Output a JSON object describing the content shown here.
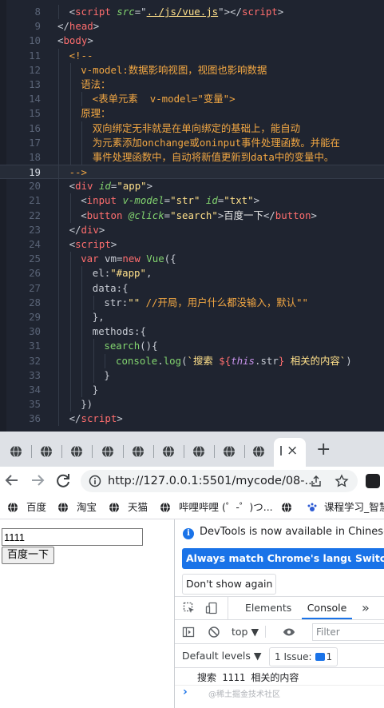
{
  "editor": {
    "lines": [
      {
        "n": "8",
        "indent": 1,
        "tokens": [
          [
            "punc",
            "<"
          ],
          [
            "tag",
            "script"
          ],
          [
            "punc",
            " "
          ],
          [
            "attr",
            "src"
          ],
          [
            "punc",
            "=\""
          ],
          [
            "url",
            "../js/vue.js"
          ],
          [
            "punc",
            "\">"
          ],
          [
            "punc",
            "</"
          ],
          [
            "tag",
            "script"
          ],
          [
            "punc",
            ">"
          ]
        ]
      },
      {
        "n": "9",
        "indent": 0,
        "tokens": [
          [
            "punc",
            "</"
          ],
          [
            "tag",
            "head"
          ],
          [
            "punc",
            ">"
          ]
        ]
      },
      {
        "n": "10",
        "indent": 0,
        "tokens": [
          [
            "punc",
            "<"
          ],
          [
            "tag",
            "body"
          ],
          [
            "punc",
            ">"
          ]
        ]
      },
      {
        "n": "11",
        "indent": 1,
        "tokens": [
          [
            "cm",
            "<!--"
          ]
        ]
      },
      {
        "n": "12",
        "indent": 2,
        "tokens": [
          [
            "cm",
            "v-model:数据影响视图，视图也影响数据"
          ]
        ]
      },
      {
        "n": "13",
        "indent": 2,
        "tokens": [
          [
            "cm",
            "语法："
          ]
        ]
      },
      {
        "n": "14",
        "indent": 3,
        "tokens": [
          [
            "cm",
            "<表单元素  v-model=\"变量\">"
          ]
        ]
      },
      {
        "n": "15",
        "indent": 2,
        "tokens": [
          [
            "cm",
            "原理："
          ]
        ]
      },
      {
        "n": "16",
        "indent": 3,
        "tokens": [
          [
            "cm",
            "双向绑定无非就是在单向绑定的基础上，能自动"
          ]
        ]
      },
      {
        "n": "17",
        "indent": 3,
        "tokens": [
          [
            "cm",
            "为元素添加onchange或oninput事件处理函数。并能在"
          ]
        ]
      },
      {
        "n": "18",
        "indent": 3,
        "tokens": [
          [
            "cm",
            "事件处理函数中，自动将新值更新到data中的变量中。"
          ]
        ]
      },
      {
        "n": "19",
        "indent": 1,
        "active": true,
        "tokens": [
          [
            "cm",
            "-->"
          ]
        ]
      },
      {
        "n": "20",
        "indent": 1,
        "tokens": [
          [
            "punc",
            "<"
          ],
          [
            "tag",
            "div"
          ],
          [
            "punc",
            " "
          ],
          [
            "attr",
            "id"
          ],
          [
            "punc",
            "="
          ],
          [
            "str",
            "\"app\""
          ],
          [
            "punc",
            ">"
          ]
        ]
      },
      {
        "n": "21",
        "indent": 2,
        "tokens": [
          [
            "punc",
            "<"
          ],
          [
            "tag",
            "input"
          ],
          [
            "punc",
            " "
          ],
          [
            "attr",
            "v-model"
          ],
          [
            "punc",
            "="
          ],
          [
            "str",
            "\"str\""
          ],
          [
            "punc",
            " "
          ],
          [
            "attr",
            "id"
          ],
          [
            "punc",
            "="
          ],
          [
            "str",
            "\"txt\""
          ],
          [
            "punc",
            ">"
          ]
        ]
      },
      {
        "n": "22",
        "indent": 2,
        "tokens": [
          [
            "punc",
            "<"
          ],
          [
            "tag",
            "button"
          ],
          [
            "punc",
            " "
          ],
          [
            "attr",
            "@click"
          ],
          [
            "punc",
            "="
          ],
          [
            "str",
            "\"search\""
          ],
          [
            "punc",
            ">"
          ],
          [
            "txt",
            "百度一下"
          ],
          [
            "punc",
            "</"
          ],
          [
            "tag",
            "button"
          ],
          [
            "punc",
            ">"
          ]
        ]
      },
      {
        "n": "23",
        "indent": 1,
        "tokens": [
          [
            "punc",
            "</"
          ],
          [
            "tag",
            "div"
          ],
          [
            "punc",
            ">"
          ]
        ]
      },
      {
        "n": "24",
        "indent": 1,
        "tokens": [
          [
            "punc",
            "<"
          ],
          [
            "tag",
            "script"
          ],
          [
            "punc",
            ">"
          ]
        ]
      },
      {
        "n": "25",
        "indent": 2,
        "tokens": [
          [
            "kw",
            "var"
          ],
          [
            "punc",
            " vm="
          ],
          [
            "kw",
            "new"
          ],
          [
            "punc",
            " "
          ],
          [
            "fn",
            "Vue"
          ],
          [
            "punc",
            "({"
          ]
        ]
      },
      {
        "n": "26",
        "indent": 3,
        "tokens": [
          [
            "punc",
            "el:"
          ],
          [
            "str",
            "\"#app\""
          ],
          [
            "punc",
            ","
          ]
        ]
      },
      {
        "n": "27",
        "indent": 3,
        "tokens": [
          [
            "punc",
            "data:{"
          ]
        ]
      },
      {
        "n": "28",
        "indent": 4,
        "tokens": [
          [
            "punc",
            "str:"
          ],
          [
            "str",
            "\"\""
          ],
          [
            "punc",
            " "
          ],
          [
            "cm",
            "//开局，用户什么都没输入，默认\"\""
          ]
        ]
      },
      {
        "n": "29",
        "indent": 3,
        "tokens": [
          [
            "punc",
            "},"
          ]
        ]
      },
      {
        "n": "30",
        "indent": 3,
        "tokens": [
          [
            "punc",
            "methods:{"
          ]
        ]
      },
      {
        "n": "31",
        "indent": 4,
        "tokens": [
          [
            "fn",
            "search"
          ],
          [
            "punc",
            "(){"
          ]
        ]
      },
      {
        "n": "32",
        "indent": 5,
        "tokens": [
          [
            "fn",
            "console"
          ],
          [
            "punc",
            "."
          ],
          [
            "fn",
            "log"
          ],
          [
            "punc",
            "("
          ],
          [
            "str",
            "`搜索 "
          ],
          [
            "kw",
            "${"
          ],
          [
            "this",
            "this"
          ],
          [
            "punc",
            ".str"
          ],
          [
            "kw",
            "}"
          ],
          [
            "str",
            " 相关的内容`"
          ],
          [
            "punc",
            ")"
          ]
        ]
      },
      {
        "n": "33",
        "indent": 4,
        "tokens": [
          [
            "punc",
            "}"
          ]
        ]
      },
      {
        "n": "34",
        "indent": 3,
        "tokens": [
          [
            "punc",
            "}"
          ]
        ]
      },
      {
        "n": "35",
        "indent": 2,
        "tokens": [
          [
            "punc",
            "})"
          ]
        ]
      },
      {
        "n": "36",
        "indent": 1,
        "tokens": [
          [
            "punc",
            "</"
          ],
          [
            "tag",
            "script"
          ],
          [
            "punc",
            ">"
          ]
        ]
      }
    ]
  },
  "browser": {
    "active_tab_close": "×",
    "new_tab": "+",
    "url": "http://127.0.0.1:5501/mycode/08-...",
    "bookmarks": [
      "百度",
      "淘宝",
      "天猫",
      "哔哩哔哩 (゜-゜)つ...",
      "课程学习_智慧"
    ]
  },
  "page": {
    "input_value": "1111",
    "button_label": "百度一下"
  },
  "devtools": {
    "info_message": "DevTools is now available in Chinese!",
    "match_language_btn": "Always match Chrome's language",
    "switch_btn": "Switch",
    "dont_show_btn": "Don't show again",
    "tabs": [
      "Elements",
      "Console"
    ],
    "more_tabs": "»",
    "context": "top ▼",
    "filter_placeholder": "Filter",
    "default_levels": "Default levels ▼",
    "issues_label": "1 Issue:",
    "issues_count": "1",
    "log_output": "搜索 1111 相关的内容",
    "prompt": "›",
    "watermark": "@稀土掘金技术社区"
  },
  "colors": {
    "editor_bg": "#1f2430",
    "accent_blue": "#1a73e8",
    "tabbar_bg": "#dee1e6"
  }
}
